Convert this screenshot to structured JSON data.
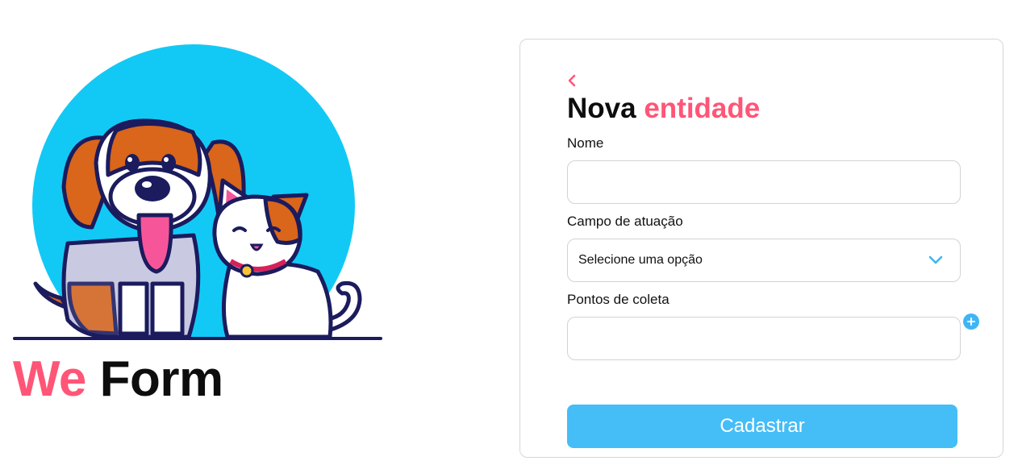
{
  "brand": {
    "we": "We",
    "form": "Form",
    "illustration_icon": "dog-and-cat-illustration",
    "accent_color": "#ff5577",
    "circle_color": "#12c9f5"
  },
  "form": {
    "back_icon": "chevron-left-icon",
    "title_part1": "Nova",
    "title_part2": "entidade",
    "nome_label": "Nome",
    "nome_value": "",
    "campo_label": "Campo de atuação",
    "campo_selected": "Selecione uma opção",
    "pontos_label": "Pontos de coleta",
    "pontos_value": "",
    "add_icon": "plus-circle-icon",
    "submit_label": "Cadastrar",
    "button_color": "#45bdf7"
  }
}
